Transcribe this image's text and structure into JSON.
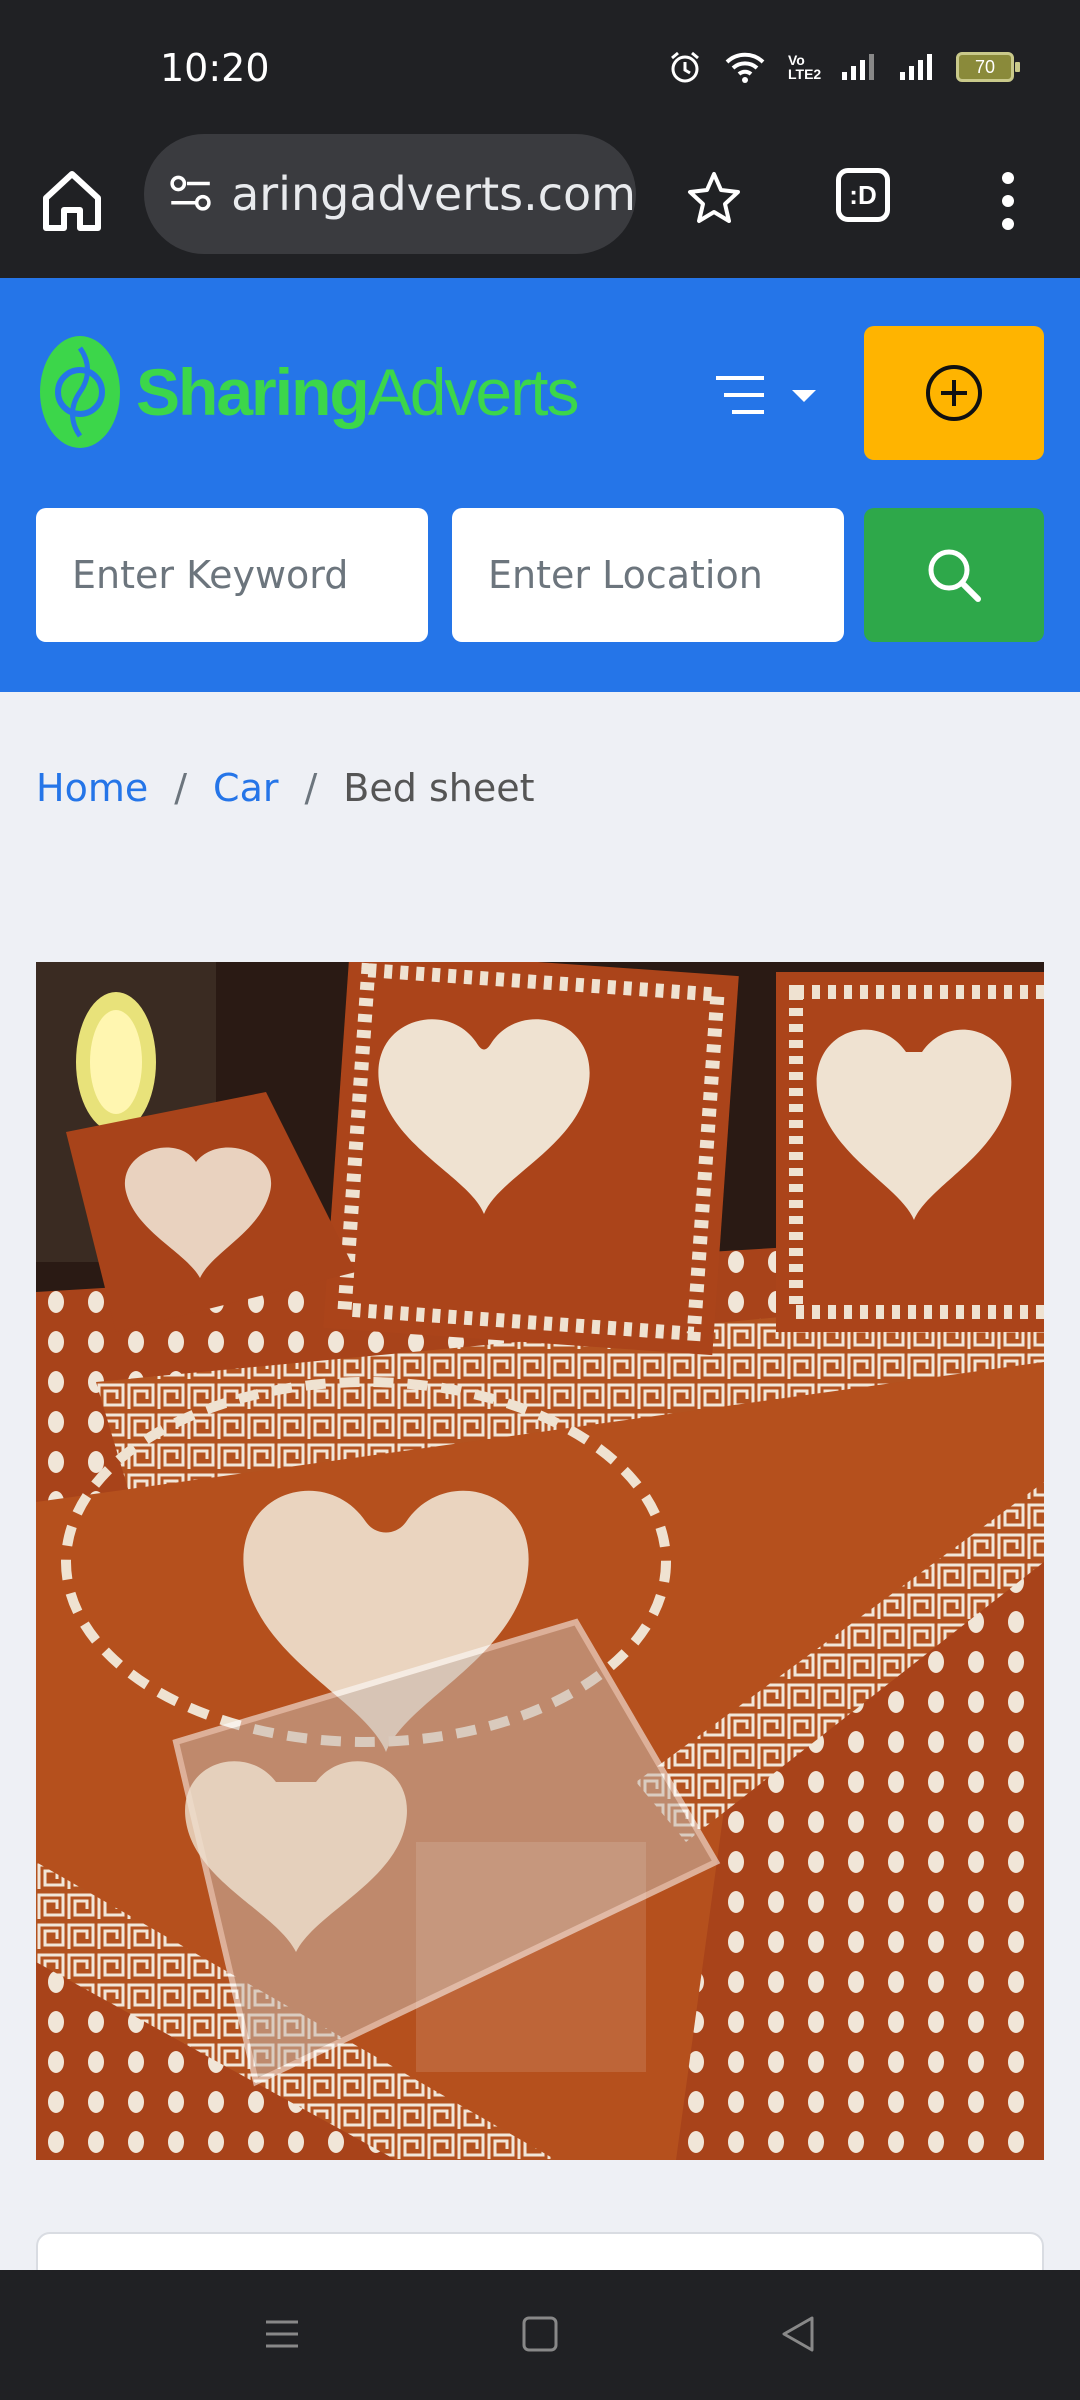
{
  "status_bar": {
    "time": "10:20",
    "battery": "70",
    "network_label": "Vo LTE2"
  },
  "browser": {
    "url": "aringadverts.com",
    "tabs_label": ":D"
  },
  "header": {
    "logo_part1": "Sharing",
    "logo_part2": "Adverts",
    "keyword_placeholder": "Enter Keyword",
    "location_placeholder": "Enter Location"
  },
  "breadcrumb": {
    "items": [
      "Home",
      "Car",
      "Bed sheet"
    ],
    "separator": "/"
  },
  "colors": {
    "brand_blue": "#2575e8",
    "logo_green": "#3cd64a",
    "post_yellow": "#ffb400",
    "search_green": "#2ea84a"
  }
}
